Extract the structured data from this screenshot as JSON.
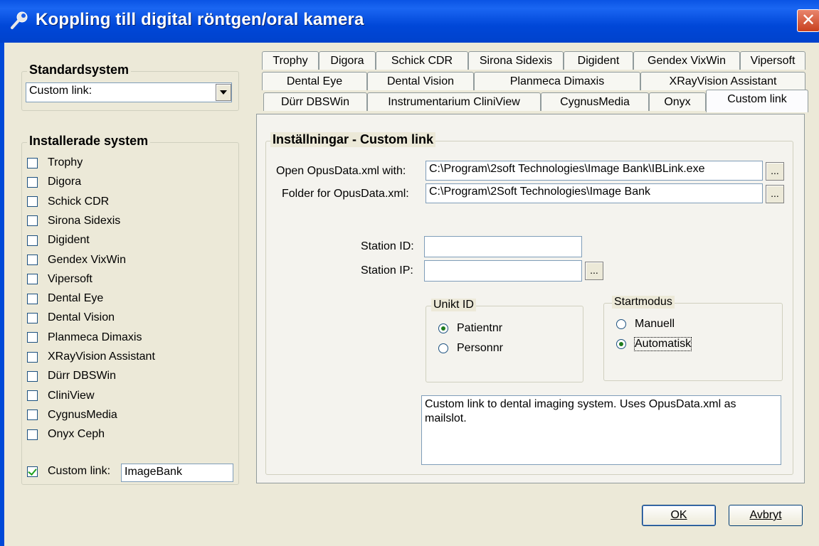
{
  "window": {
    "title": "Koppling till digital röntgen/oral kamera",
    "close_label": "✕"
  },
  "standard": {
    "title": "Standardsystem",
    "selected": "Custom link:"
  },
  "installed": {
    "title": "Installerade system",
    "items": [
      {
        "label": "Trophy",
        "checked": false
      },
      {
        "label": "Digora",
        "checked": false
      },
      {
        "label": "Schick CDR",
        "checked": false
      },
      {
        "label": "Sirona Sidexis",
        "checked": false
      },
      {
        "label": "Digident",
        "checked": false
      },
      {
        "label": "Gendex VixWin",
        "checked": false
      },
      {
        "label": "Vipersoft",
        "checked": false
      },
      {
        "label": "Dental Eye",
        "checked": false
      },
      {
        "label": "Dental Vision",
        "checked": false
      },
      {
        "label": "Planmeca Dimaxis",
        "checked": false
      },
      {
        "label": "XRayVision Assistant",
        "checked": false
      },
      {
        "label": "Dürr DBSWin",
        "checked": false
      },
      {
        "label": "CliniView",
        "checked": false
      },
      {
        "label": "CygnusMedia",
        "checked": false
      },
      {
        "label": "Onyx Ceph",
        "checked": false
      }
    ],
    "custom": {
      "label": "Custom link:",
      "checked": true,
      "value": "ImageBank"
    }
  },
  "tabs": {
    "row1": [
      "Trophy",
      "Digora",
      "Schick CDR",
      "Sirona Sidexis",
      "Digident",
      "Gendex VixWin",
      "Vipersoft"
    ],
    "row2": [
      "Dental Eye",
      "Dental Vision",
      "Planmeca Dimaxis",
      "XRayVision Assistant"
    ],
    "row3": [
      "Dürr DBSWin",
      "Instrumentarium CliniView",
      "CygnusMedia",
      "Onyx",
      "Custom link"
    ],
    "active": "Custom link"
  },
  "settings": {
    "title": "Inställningar - Custom link",
    "open_label": "Open OpusData.xml with:",
    "open_value": "C:\\Program\\2soft Technologies\\Image Bank\\IBLink.exe",
    "folder_label": "Folder for OpusData.xml:",
    "folder_value": "C:\\Program\\2Soft Technologies\\Image Bank",
    "browse": "...",
    "station_id_label": "Station ID:",
    "station_id_value": "",
    "station_ip_label": "Station IP:",
    "station_ip_value": "",
    "unikt": {
      "title": "Unikt ID",
      "options": [
        {
          "label": "Patientnr",
          "selected": true
        },
        {
          "label": "Personnr",
          "selected": false
        }
      ]
    },
    "startmodus": {
      "title": "Startmodus",
      "options": [
        {
          "label": "Manuell",
          "selected": false
        },
        {
          "label": "Automatisk",
          "selected": true
        }
      ]
    },
    "description": "Custom link to dental imaging system. Uses OpusData.xml as mailslot."
  },
  "buttons": {
    "ok": "OK",
    "cancel": "Avbryt"
  }
}
